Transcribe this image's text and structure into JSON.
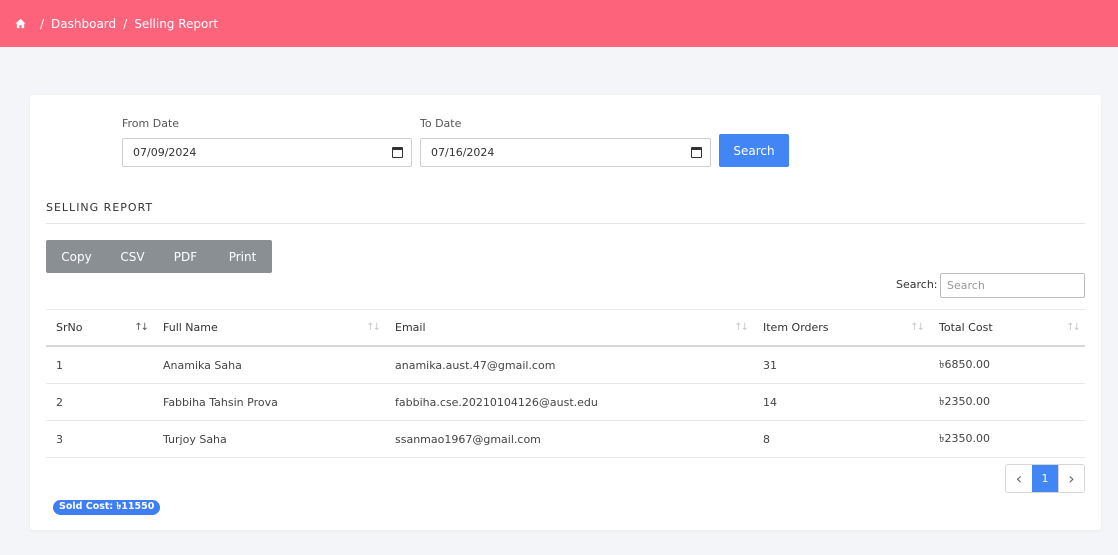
{
  "breadcrumb": {
    "dashboard": "Dashboard",
    "separator": "/",
    "current": "Selling Report"
  },
  "filters": {
    "from_label": "From Date",
    "from_value": "07/09/2024",
    "to_label": "To Date",
    "to_value": "07/16/2024",
    "search_button": "Search"
  },
  "report": {
    "title": "SELLING REPORT"
  },
  "export_buttons": [
    "Copy",
    "CSV",
    "PDF",
    "Print"
  ],
  "table_search": {
    "label": "Search:",
    "placeholder": "Search"
  },
  "table": {
    "headers": [
      "SrNo",
      "Full Name",
      "Email",
      "Item Orders",
      "Total Cost"
    ],
    "rows": [
      [
        "1",
        "Anamika Saha",
        "anamika.aust.47@gmail.com",
        "31",
        "৳6850.00"
      ],
      [
        "2",
        "Fabbiha Tahsin Prova",
        "fabbiha.cse.20210104126@aust.edu",
        "14",
        "৳2350.00"
      ],
      [
        "3",
        "Turjoy Saha",
        "ssanmao1967@gmail.com",
        "8",
        "৳2350.00"
      ]
    ]
  },
  "pagination": {
    "prev": "‹",
    "current": "1",
    "next": "›"
  },
  "summary": {
    "sold_cost": "Sold Cost: ৳11550"
  },
  "colors": {
    "header_bg": "#fe637c",
    "primary": "#4285f4",
    "export_bg": "#8a8f94",
    "badge": "#3f7ef2"
  },
  "icons": {
    "home": "home-icon",
    "calendar": "calendar-icon",
    "sort": "sort-icon"
  }
}
